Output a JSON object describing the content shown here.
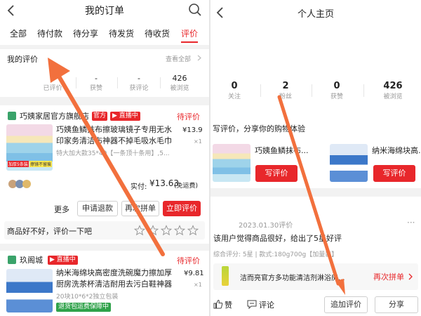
{
  "left": {
    "title": "我的订单",
    "tabs": [
      {
        "label": "全部",
        "active": false
      },
      {
        "label": "待付款",
        "active": false
      },
      {
        "label": "待分享",
        "active": false
      },
      {
        "label": "待发货",
        "active": false
      },
      {
        "label": "待收货",
        "active": false
      },
      {
        "label": "评价",
        "active": true
      }
    ],
    "review": {
      "title": "我的评价",
      "view_all": "查看全部",
      "stats": [
        {
          "value": "5",
          "label": "已评价"
        },
        {
          "value": "-",
          "label": "获赞"
        },
        {
          "value": "-",
          "label": "获评论"
        },
        {
          "value": "426",
          "label": "被浏览"
        }
      ]
    },
    "order1": {
      "shop": "巧姨家居官方旗舰店",
      "official_tag": "官方",
      "live_tag": "直播中",
      "status": "待评价",
      "product": "巧姨鱼鳞抹布擦玻璃镜子专用无水印家务清洁布神器不掉毛吸水毛巾",
      "spec": "特大加大款35*40【一条顶十条用】,5...",
      "price": "¥13.9",
      "qty": "×1",
      "thumb_tag1": "加厚5条装",
      "thumb_tag2": "擦镜不留痕",
      "paid_label": "实付:",
      "paid_value": "¥13.63",
      "paid_note": "(免运费)",
      "actions": [
        "更多",
        "申请退款",
        "再次拼单",
        "立即评价"
      ],
      "prompt": "商品好不好，评价一下吧"
    },
    "order2": {
      "shop": "玖阁城",
      "live_tag": "直播中",
      "status": "待评价",
      "product": "纳米海绵块高密度洗碗魔力擦加厚厨房洗茶杯清洁耐用去污白鞋神器",
      "spec": "20块10*6*2独立包装",
      "price": "¥9.81",
      "qty": "×1",
      "tag": "退货包运费保障中"
    }
  },
  "right": {
    "title": "个人主页",
    "stats": [
      {
        "value": "0",
        "label": "关注"
      },
      {
        "value": "2",
        "label": "粉丝"
      },
      {
        "value": "0",
        "label": "获赞"
      },
      {
        "value": "426",
        "label": "被浏览"
      }
    ],
    "prompt": "写评价，分享你的购物体验",
    "cards": [
      {
        "name": "巧姨鱼鳞抹布...",
        "button": "写评价"
      },
      {
        "name": "纳米海绵块高...",
        "button": "写评价"
      }
    ],
    "post": {
      "date": "2023.01.30评价",
      "more": "···",
      "text": "该用户觉得商品很好，给出了5星好评",
      "meta": "综合评分: 5星 | 款式:180g700g【加量装】",
      "product": "洁而亮官方多功能清洁剂淋浴房...",
      "reorder": "再次拼单",
      "actions": {
        "like": "赞",
        "comment": "评论",
        "append": "追加评价",
        "share": "分享"
      }
    }
  },
  "colors": {
    "accent": "#e8272b",
    "arrow": "#f2703d"
  }
}
